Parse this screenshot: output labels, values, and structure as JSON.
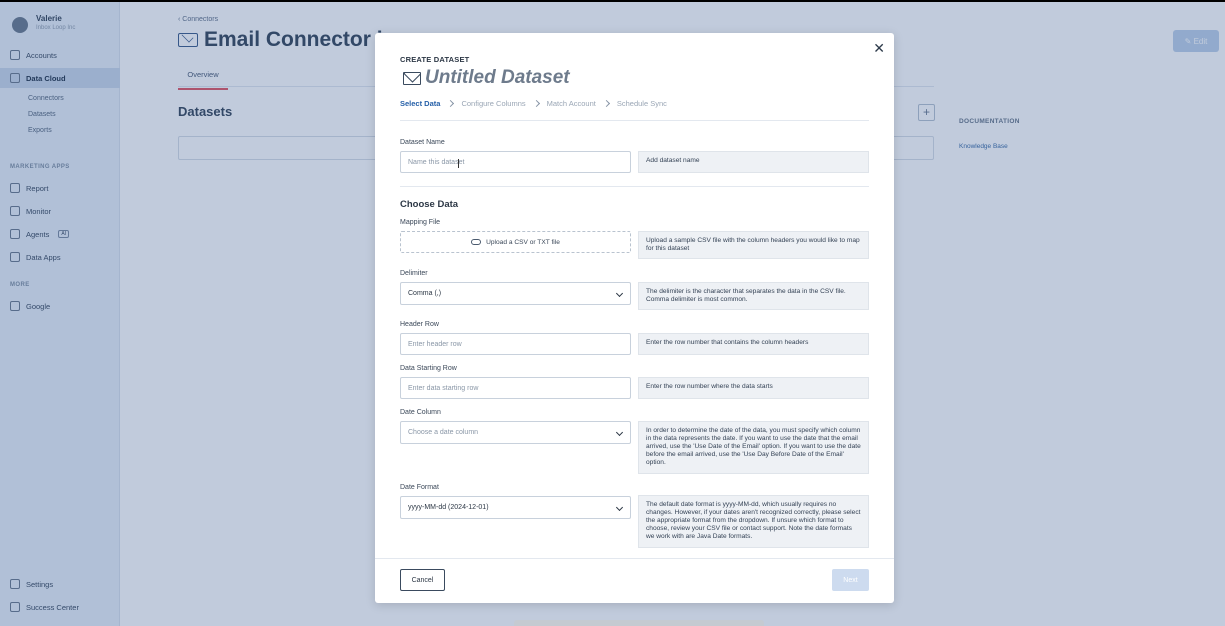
{
  "sidebar": {
    "user_name": "Valerie",
    "org": "Inbox Loop Inc",
    "nav": {
      "accounts": "Accounts",
      "data_cloud": "Data Cloud",
      "connectors": "Connectors",
      "datasets": "Datasets",
      "exports": "Exports",
      "marketing_apps": "MARKETING APPS",
      "report": "Report",
      "monitor": "Monitor",
      "agents": "Agents",
      "agents_badge": "AI",
      "data_apps": "Data Apps",
      "more": "MORE",
      "google": "Google",
      "settings": "Settings",
      "success_center": "Success Center"
    }
  },
  "page": {
    "breadcrumb": "Connectors",
    "title": "Email Connector is c",
    "tab_overview": "Overview",
    "datasets_heading": "Datasets",
    "edit_label": "Edit",
    "documentation_label": "DOCUMENTATION",
    "knowledge_base": "Knowledge Base"
  },
  "modal": {
    "tag": "CREATE DATASET",
    "title": "Untitled Dataset",
    "steps": [
      "Select Data",
      "Configure Columns",
      "Match Account",
      "Schedule Sync"
    ],
    "dataset_name": {
      "label": "Dataset Name",
      "placeholder": "Name this dataset",
      "help": "Add dataset name"
    },
    "choose_data": "Choose Data",
    "mapping_file": {
      "label": "Mapping File",
      "button": "Upload a CSV or TXT file",
      "help": "Upload a sample CSV file with the column headers you would like to map for this dataset"
    },
    "delimiter": {
      "label": "Delimiter",
      "value": "Comma (,)",
      "help": "The delimiter is the character that separates the data in the CSV file. Comma delimiter is most common."
    },
    "header_row": {
      "label": "Header Row",
      "placeholder": "Enter header row",
      "help": "Enter the row number that contains the column headers"
    },
    "data_starting_row": {
      "label": "Data Starting Row",
      "placeholder": "Enter data starting row",
      "help": "Enter the row number where the data starts"
    },
    "date_column": {
      "label": "Date Column",
      "value": "Choose a date column",
      "help": "In order to determine the date of the data, you must specify which column in the data represents the date. If you want to use the date that the email arrived, use the 'Use Date of the Email' option. If you want to use the date before the email arrived, use the 'Use Day Before Date of the Email' option."
    },
    "date_format": {
      "label": "Date Format",
      "value": "yyyy-MM-dd (2024-12-01)",
      "help": "The default date format is yyyy-MM-dd, which usually requires no changes. However, if your dates aren't recognized correctly, please select the appropriate format from the dropdown. If unsure which format to choose, review your CSV file or contact support. Note the date formats we work with are Java Date formats."
    },
    "cancel": "Cancel",
    "next": "Next"
  }
}
